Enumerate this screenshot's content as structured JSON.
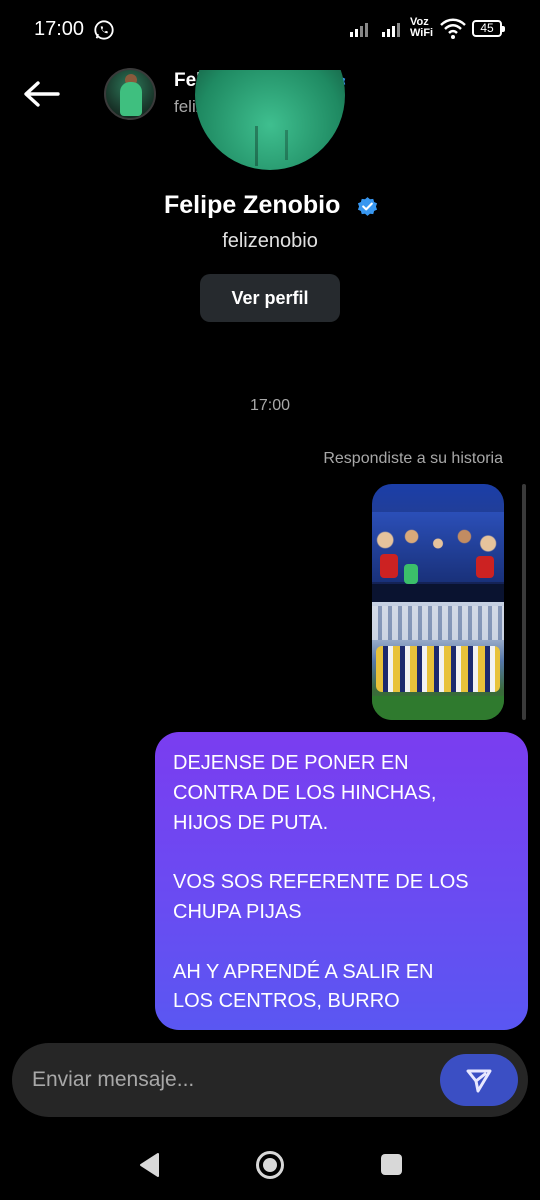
{
  "status_bar": {
    "time": "17:00",
    "network_label_1": "Voz",
    "network_label_2": "WiFi",
    "battery": "45",
    "icons": [
      "whatsapp-icon",
      "signal-icon",
      "signal-icon",
      "wifi-icon",
      "battery-icon"
    ]
  },
  "header": {
    "name": "Felipe Zenobio",
    "username": "felizenobio",
    "verified": true
  },
  "profile": {
    "name": "Felipe Zenobio",
    "username": "felizenobio",
    "view_profile_label": "Ver perfil"
  },
  "conversation": {
    "timestamp": "17:00",
    "story_reply_label": "Respondiste a su historia",
    "message": "DEJENSE DE PONER EN\nCONTRA DE LOS HINCHAS,\nHIJOS DE PUTA.\n\nVOS SOS REFERENTE DE LOS\nCHUPA PIJAS\n\nAH Y APRENDÉ A SALIR EN\nLOS CENTROS, BURRO"
  },
  "composer": {
    "placeholder": "Enviar mensaje..."
  },
  "colors": {
    "background": "#000000",
    "bubble_top": "#7a3df0",
    "bubble_bottom": "#5a57f2",
    "verified": "#3897f0",
    "send_button": "#3b4fc4"
  }
}
